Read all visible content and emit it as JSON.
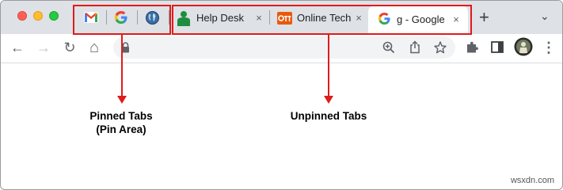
{
  "window": {
    "controls": [
      "close",
      "minimize",
      "maximize"
    ]
  },
  "pinned_tabs": [
    {
      "icon": "gmail-icon"
    },
    {
      "icon": "google-icon"
    },
    {
      "icon": "globe-icon"
    }
  ],
  "tabs": [
    {
      "title": "Help Desk",
      "icon": "person-icon",
      "close": "×"
    },
    {
      "title": "Online Tech",
      "icon": "ott-icon",
      "close": "×"
    },
    {
      "title": "g - Google",
      "icon": "google-icon",
      "close": "×",
      "active": true
    }
  ],
  "new_tab": "+",
  "tab_menu": "⌄",
  "toolbar": {
    "back": "←",
    "forward": "→",
    "reload": "↻",
    "home": "⌂",
    "menu": "⋮"
  },
  "annotations": {
    "pinned_line1": "Pinned Tabs",
    "pinned_line2": "(Pin Area)",
    "unpinned": "Unpinned Tabs"
  },
  "watermark": "wsxdn.com",
  "colors": {
    "highlight": "#e01b1b",
    "tabstrip": "#dee1e6",
    "gmail_red": "#ea4335",
    "ott_orange": "#e8590c",
    "helpdesk_green": "#1e8e3e"
  }
}
